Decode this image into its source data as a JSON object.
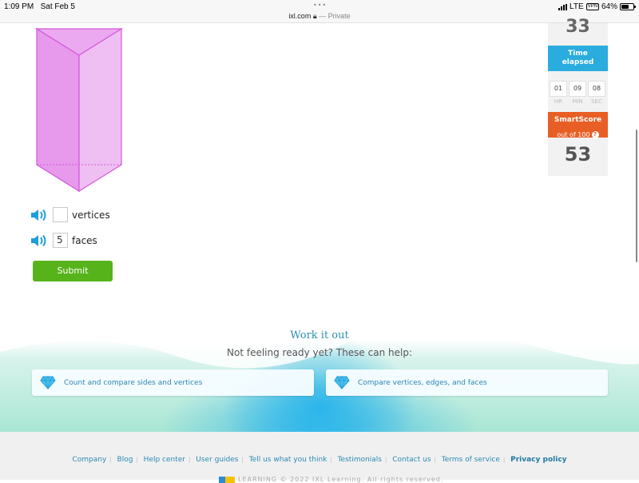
{
  "status_bar": {
    "time": "1:09 PM",
    "date": "Sat Feb 5",
    "dots": "•••",
    "url": "ixl.com",
    "private_label": "— Private",
    "network": "LTE",
    "vpn": "VPN",
    "battery": "64%",
    "battery_level": 0.64
  },
  "question": {
    "rows": [
      {
        "value": "",
        "label": "vertices"
      },
      {
        "value": "5",
        "label": "faces"
      }
    ],
    "submit_label": "Submit"
  },
  "side_panel": {
    "questions_answered": "33",
    "time_header": [
      "Time",
      "elapsed"
    ],
    "timer": [
      {
        "value": "01",
        "unit": "HR"
      },
      {
        "value": "09",
        "unit": "MIN"
      },
      {
        "value": "08",
        "unit": "SEC"
      }
    ],
    "smartscore_title": "SmartScore",
    "smartscore_sub": "out of 100",
    "smartscore_help": "?",
    "smartscore": "53"
  },
  "work_it_out": {
    "title": "Work it out",
    "subtitle": "Not feeling ready yet? These can help:",
    "skills": [
      {
        "label": "Count and compare sides and vertices"
      },
      {
        "label": "Compare vertices, edges, and faces"
      }
    ]
  },
  "footer": {
    "links": [
      "Company",
      "Blog",
      "Help center",
      "User guides",
      "Tell us what you think",
      "Testimonials",
      "Contact us",
      "Terms of service",
      "Privacy policy"
    ],
    "copyright": "LEARNING © 2022 IXL Learning. All rights reserved."
  },
  "colors": {
    "prism_fill_left": "#e799ec",
    "prism_fill_right": "#efbff3",
    "prism_stroke": "#d458dc",
    "submit_green": "#56b41a",
    "time_blue": "#2aacdf",
    "smartscore_orange": "#e85f25",
    "link_blue": "#2a8bb5"
  }
}
